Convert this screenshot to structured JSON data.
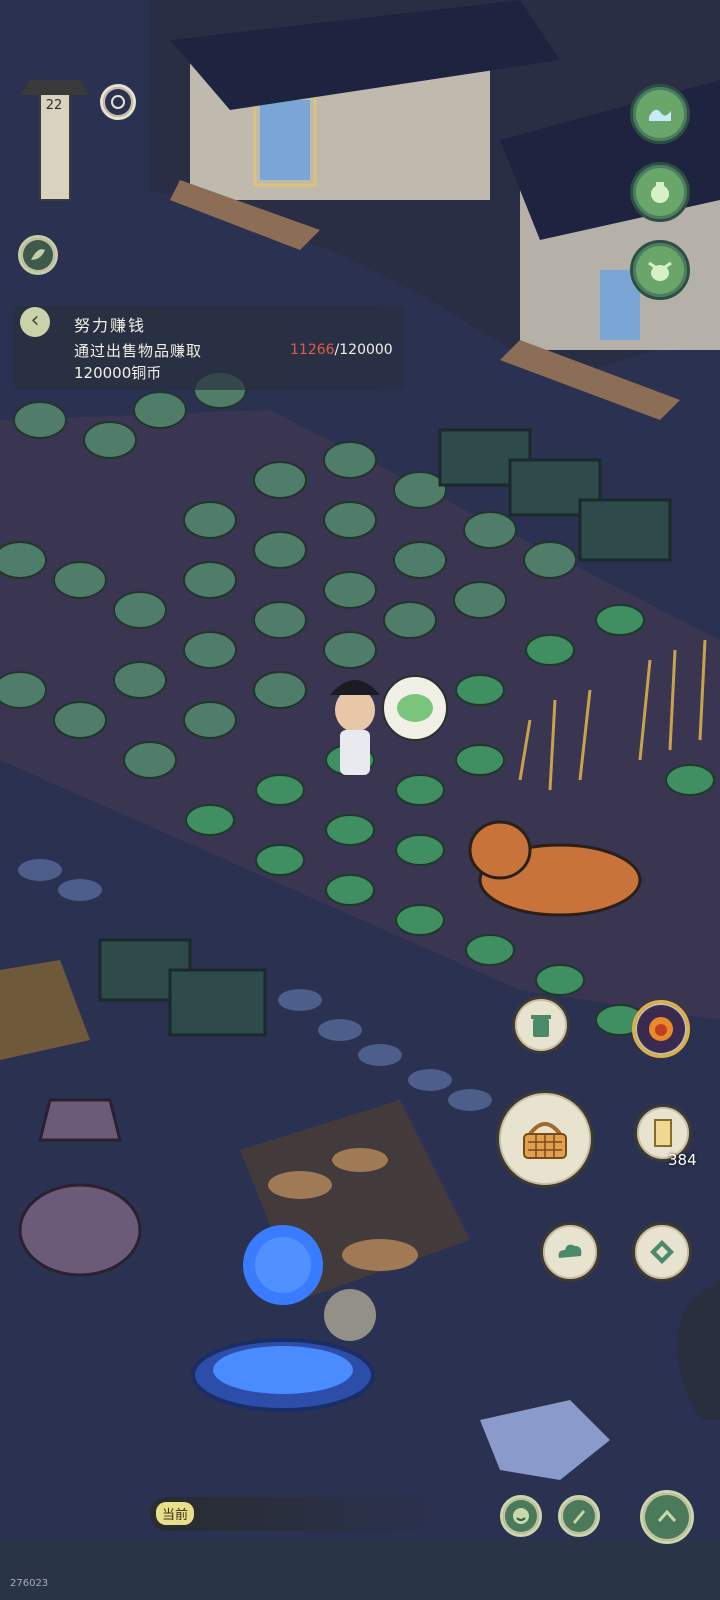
{
  "hud": {
    "level": "22"
  },
  "quest": {
    "title": "努力赚钱",
    "description": "通过出售物品赚取",
    "target_text": "120000铜币",
    "progress_current": "11266",
    "progress_total": "/120000"
  },
  "inventory": {
    "ticket_count": "384"
  },
  "chat": {
    "channel_label": "当前"
  },
  "footer": {
    "build_id": "276023"
  },
  "icons": {
    "top_right": [
      "wave-icon",
      "pot-icon",
      "ox-icon"
    ],
    "right_column": [
      "trash-icon",
      "lion-mask-icon",
      "basket-icon",
      "scroll-icon",
      "cloud-icon",
      "diamond-icon"
    ],
    "bottom": [
      "smile-icon",
      "brush-icon",
      "chevron-up-icon"
    ]
  },
  "colors": {
    "night_ground": "#2b3150",
    "field_soil": "#3a3550",
    "accent_red": "#e25a4a",
    "button_cream": "#e8e3cf",
    "button_green": "#6aa66a",
    "portal_blue": "#3a7cff"
  }
}
